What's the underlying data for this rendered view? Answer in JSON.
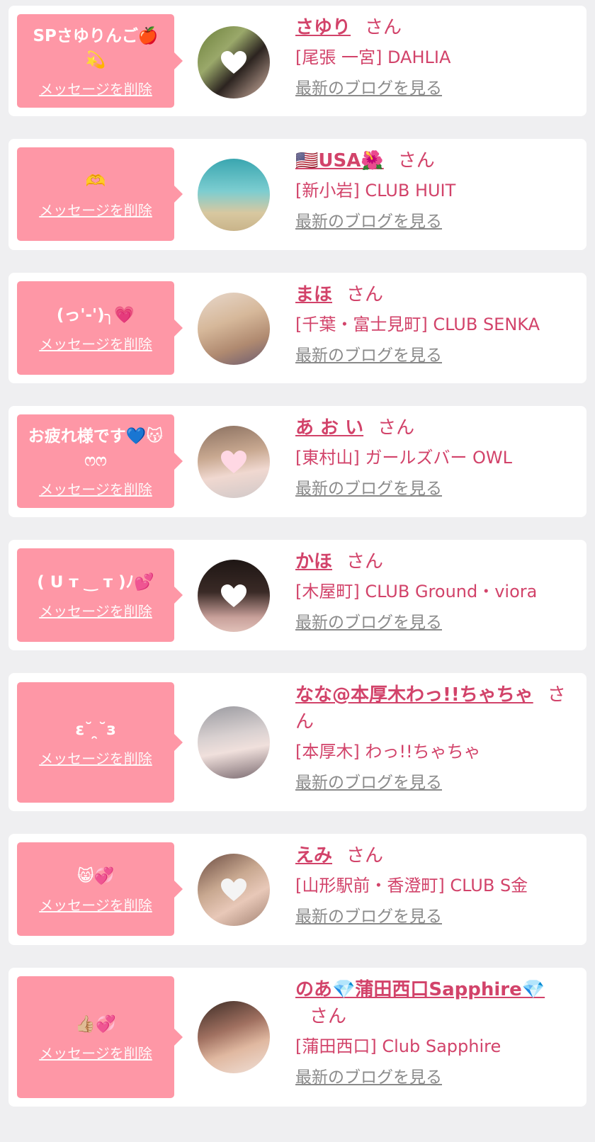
{
  "delete_label": "メッセージを削除",
  "honorific": "さん",
  "blog_label": "最新のブログを見る",
  "colors": {
    "bubble": "#fe97a6",
    "accent": "#d2436a",
    "background": "#efeff1",
    "link_gray": "#8a8a8a"
  },
  "favorites": [
    {
      "message": "SPさゆりんご🍎💫",
      "name": "さゆり",
      "shop": "[尾張 一宮] DAHLIA",
      "avatar_icon": "girl-with-strawberries-photo"
    },
    {
      "message": "🫶",
      "name": "🇺🇸USA🌺",
      "shop": "[新小岩] CLUB HUIT",
      "avatar_icon": "beach-photo"
    },
    {
      "message": "(っ'-')╮💗",
      "name": "まほ",
      "shop": "[千葉・富士見町] CLUB SENKA",
      "avatar_icon": "blonde-girl-photo"
    },
    {
      "message": "お疲れ様です💙😽ෆෆ",
      "name": "あ お い",
      "shop": "[東村山] ガールズバー OWL",
      "avatar_icon": "girl-selfie-photo"
    },
    {
      "message": "( ᑌ т ‿ т )ﾉ💕",
      "name": "かほ",
      "shop": "[木屋町] CLUB Ground・viora",
      "avatar_icon": "dark-hair-girl-photo"
    },
    {
      "message": "ε˘ ̯˘з",
      "name": "なな@本厚木わっ!!ちゃちゃ",
      "shop": "[本厚木] わっ!!ちゃちゃ",
      "avatar_icon": "veiled-girl-photo"
    },
    {
      "message": "😸💞",
      "name": "えみ",
      "shop": "[山形駅前・香澄町] CLUB S金",
      "avatar_icon": "girl-closeup-photo"
    },
    {
      "message": "👍🏼💞",
      "name": "のあ💎蒲田西口Sapphire💎",
      "shop": "[蒲田西口] Club Sapphire",
      "avatar_icon": "peace-sign-girl-photo"
    }
  ]
}
